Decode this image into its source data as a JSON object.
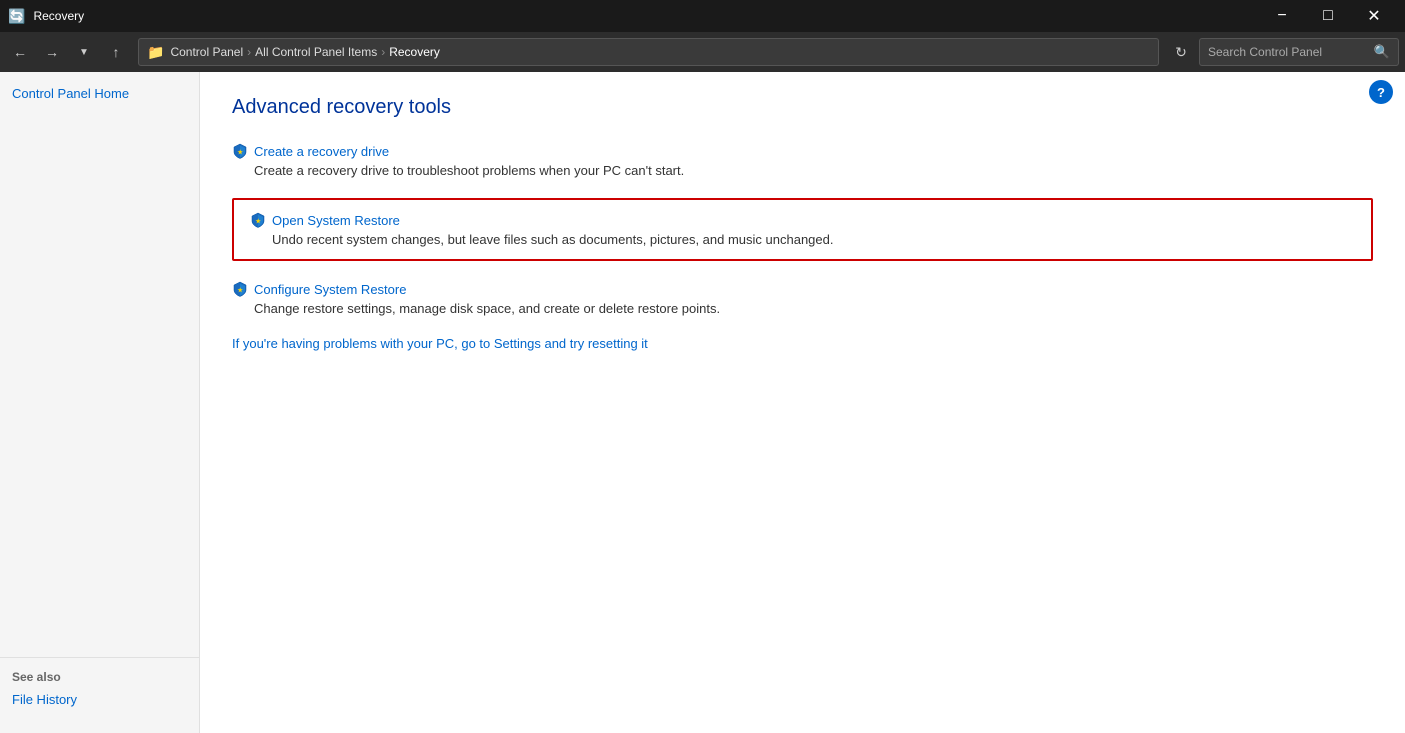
{
  "window": {
    "title": "Recovery",
    "icon": "🛡"
  },
  "titlebar": {
    "minimize_label": "−",
    "maximize_label": "□",
    "close_label": "✕"
  },
  "addressbar": {
    "search_placeholder": "Search Control Panel",
    "breadcrumb": [
      {
        "label": "Control Panel",
        "sep": true
      },
      {
        "label": "All Control Panel Items",
        "sep": true
      },
      {
        "label": "Recovery",
        "sep": false
      }
    ]
  },
  "sidebar": {
    "nav_label": "Control Panel Home",
    "see_also": {
      "heading": "See also",
      "items": [
        {
          "label": "File History"
        }
      ]
    }
  },
  "content": {
    "page_title": "Advanced recovery tools",
    "tools": [
      {
        "id": "recovery-drive",
        "link_text": "Create a recovery drive",
        "description": "Create a recovery drive to troubleshoot problems when your PC can't start.",
        "highlighted": false
      },
      {
        "id": "open-system-restore",
        "link_text": "Open System Restore",
        "description": "Undo recent system changes, but leave files such as documents, pictures, and music unchanged.",
        "highlighted": true
      },
      {
        "id": "configure-system-restore",
        "link_text": "Configure System Restore",
        "description": "Change restore settings, manage disk space, and create or delete restore points.",
        "highlighted": false
      }
    ],
    "settings_link": "If you're having problems with your PC, go to Settings and try resetting it"
  }
}
